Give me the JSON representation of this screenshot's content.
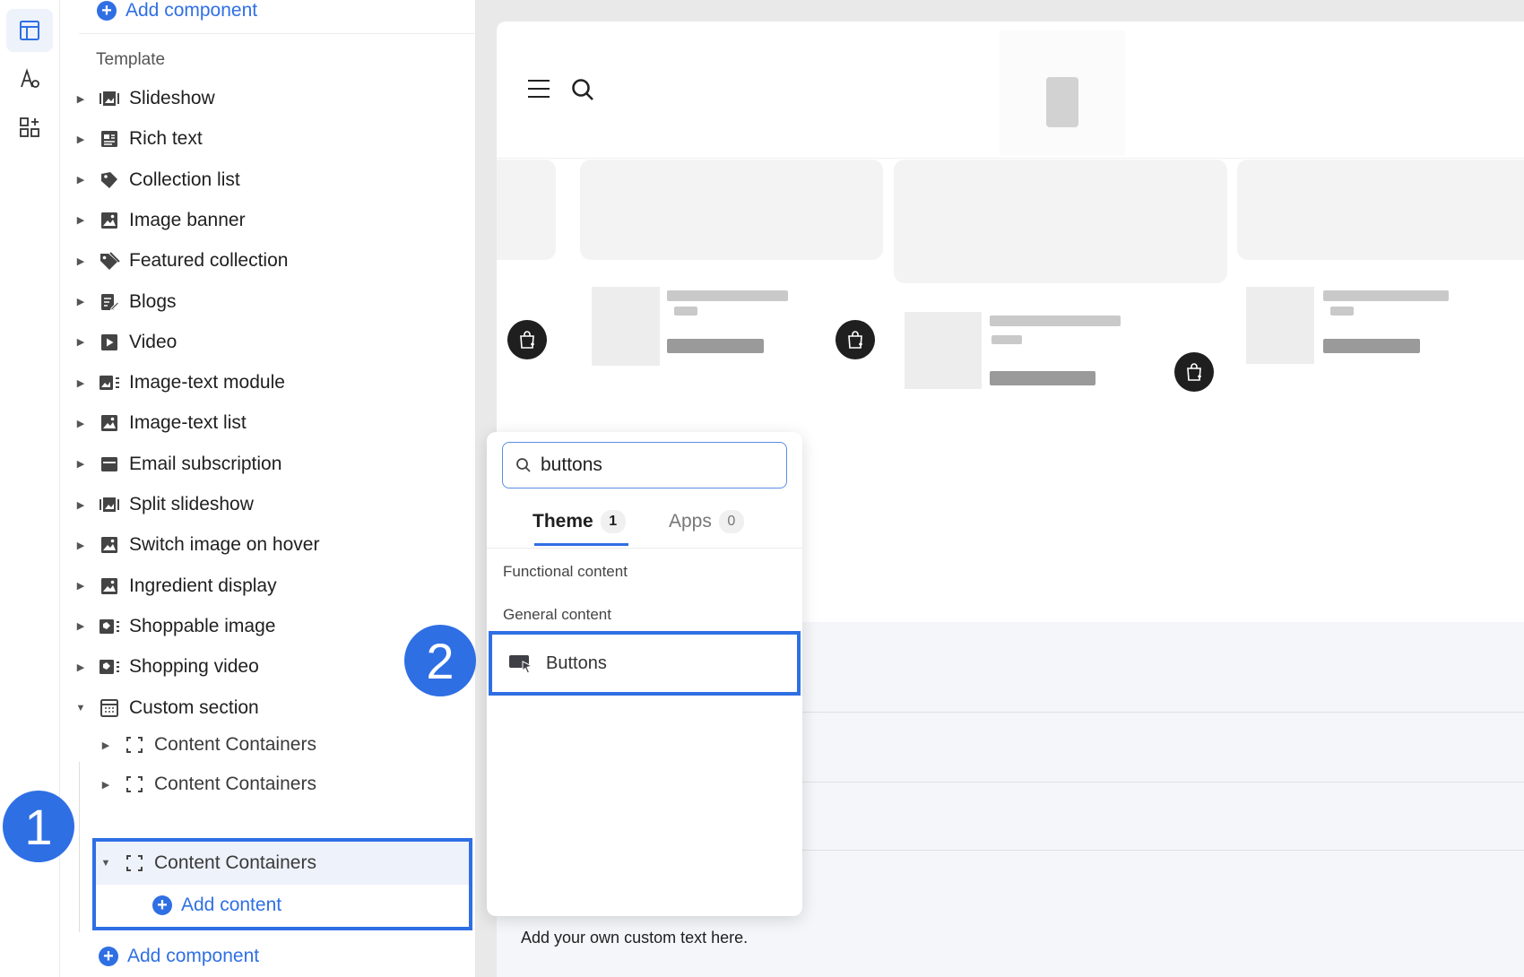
{
  "sidebar": {
    "add_component_label": "Add component",
    "template_label": "Template",
    "sections": [
      {
        "label": "Slideshow",
        "icon": "slideshow-icon"
      },
      {
        "label": "Rich text",
        "icon": "rich-text-icon"
      },
      {
        "label": "Collection list",
        "icon": "collection-list-icon"
      },
      {
        "label": "Image banner",
        "icon": "image-icon"
      },
      {
        "label": "Featured collection",
        "icon": "tag-icon"
      },
      {
        "label": "Blogs",
        "icon": "blog-icon"
      },
      {
        "label": "Video",
        "icon": "video-icon"
      },
      {
        "label": "Image-text module",
        "icon": "image-text-icon"
      },
      {
        "label": "Image-text list",
        "icon": "image-icon"
      },
      {
        "label": "Email subscription",
        "icon": "email-icon"
      },
      {
        "label": "Split slideshow",
        "icon": "slideshow-icon"
      },
      {
        "label": "Switch image on hover",
        "icon": "image-icon"
      },
      {
        "label": "Ingredient display",
        "icon": "image-icon"
      },
      {
        "label": "Shoppable image",
        "icon": "shoppable-icon"
      },
      {
        "label": "Shopping video",
        "icon": "shoppable-icon"
      },
      {
        "label": "Custom section",
        "icon": "custom-section-icon"
      }
    ],
    "children": [
      {
        "label": "Content Containers"
      },
      {
        "label": "Content Containers"
      },
      {
        "label": "Content Containers"
      }
    ],
    "add_content_label": "Add content",
    "add_component_bottom_label": "Add component"
  },
  "callouts": {
    "step1": "1",
    "step2": "2"
  },
  "popover": {
    "search_value": "buttons",
    "tabs": [
      {
        "label": "Theme",
        "count": "1",
        "active": true
      },
      {
        "label": "Apps",
        "count": "0",
        "active": false
      }
    ],
    "groups": [
      "Functional content",
      "General content"
    ],
    "result_label": "Buttons"
  },
  "preview": {
    "custom_text": "Add your own custom text here."
  },
  "colors": {
    "accent": "#2f6fe4"
  }
}
